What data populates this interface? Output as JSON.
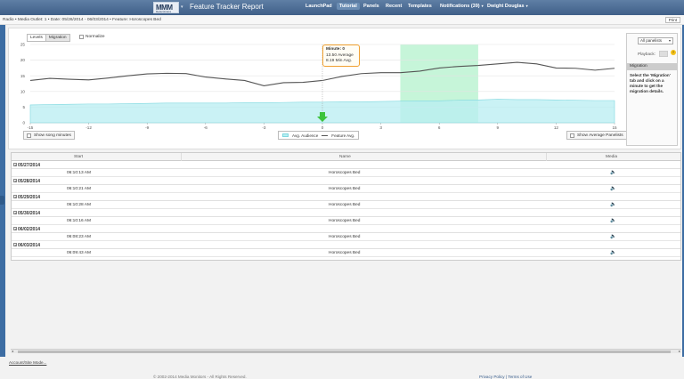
{
  "header": {
    "logo_text": "MMM",
    "logo_sub": "Media Monitors",
    "title": "Feature Tracker Report",
    "nav": [
      {
        "label": "LaunchPad"
      },
      {
        "label": "Tutorial"
      },
      {
        "label": "Panels"
      },
      {
        "label": "Recent"
      },
      {
        "label": "Templates"
      },
      {
        "label": "Notifications (39)"
      },
      {
        "label": "Dwight Douglas"
      }
    ]
  },
  "breadcrumb": "Radio • Media Outlet: 1 • Date: 05/26/2014 - 06/03/2014 • Feature: Horoscopes Bed",
  "print_label": "Print",
  "chart_controls": {
    "tabs": [
      "Levels",
      "Migration"
    ],
    "normalize_label": "Normalize",
    "song_minutes_label": "Show song minutes",
    "avg_panelists_label": "Show Average Panelists"
  },
  "tooltip": {
    "title": "Minute: 0",
    "line1": "13.50 Average",
    "line2": "8.19 Min Avg."
  },
  "chart_data": {
    "type": "line",
    "x": [
      -15,
      -14,
      -13,
      -12,
      -11,
      -10,
      -9,
      -8,
      -7,
      -6,
      -5,
      -4,
      -3,
      -2,
      -1,
      0,
      1,
      2,
      3,
      4,
      5,
      6,
      7,
      8,
      9,
      10,
      11,
      12,
      13,
      14,
      15
    ],
    "xticks": [
      -15,
      -12,
      -9,
      -6,
      -3,
      0,
      3,
      6,
      9,
      12,
      15
    ],
    "ylim": [
      0,
      25
    ],
    "yticks": [
      0,
      5,
      10,
      15,
      20,
      25
    ],
    "series": [
      {
        "name": "Feature Avg.",
        "type": "line",
        "color": "#555555",
        "values": [
          13.5,
          14.2,
          13.9,
          13.7,
          14.3,
          15.0,
          15.6,
          15.8,
          15.7,
          14.6,
          14.0,
          13.5,
          11.8,
          12.8,
          12.9,
          13.5,
          14.8,
          15.7,
          16.0,
          16.0,
          16.5,
          17.5,
          18.0,
          18.3,
          18.8,
          19.3,
          18.8,
          17.5,
          17.4,
          16.8,
          17.4
        ]
      },
      {
        "name": "Avg. Audience",
        "type": "area",
        "color": "#b8eef2",
        "values": [
          5.7,
          5.8,
          5.9,
          6.0,
          6.0,
          6.1,
          6.2,
          6.3,
          6.3,
          6.3,
          6.3,
          6.4,
          6.4,
          6.5,
          6.6,
          6.6,
          6.7,
          6.7,
          6.8,
          6.9,
          7.0,
          7.0,
          7.2,
          7.3,
          7.5,
          7.4,
          7.4,
          7.3,
          7.2,
          7.1,
          7.1
        ]
      }
    ],
    "highlight_range": [
      4,
      8
    ],
    "highlight_color": "#c6f5d9",
    "marker_x": 0,
    "marker_color": "#3cc33c"
  },
  "side_panel": {
    "select_value": "All panelists",
    "playback_label": "Playback:",
    "help_label": "?",
    "migration_title": "Migration",
    "migration_text": "Select the 'Migration' tab and click on a minute to get the migration details."
  },
  "table": {
    "columns": [
      "Start",
      "Name",
      "Media"
    ],
    "groups": [
      {
        "date": "05/27/2014",
        "rows": [
          {
            "start": "06:10:13 AM",
            "name": "Horoscopes Bed"
          }
        ]
      },
      {
        "date": "05/28/2014",
        "rows": [
          {
            "start": "06:10:21 AM",
            "name": "Horoscopes Bed"
          }
        ]
      },
      {
        "date": "05/29/2014",
        "rows": [
          {
            "start": "06:10:28 AM",
            "name": "Horoscopes Bed"
          }
        ]
      },
      {
        "date": "05/30/2014",
        "rows": [
          {
            "start": "06:10:16 AM",
            "name": "Horoscopes Bed"
          }
        ]
      },
      {
        "date": "06/02/2014",
        "rows": [
          {
            "start": "06:08:23 AM",
            "name": "Horoscopes Bed"
          }
        ]
      },
      {
        "date": "06/03/2014",
        "rows": [
          {
            "start": "06:09:43 AM",
            "name": "Horoscopes Bed"
          }
        ]
      }
    ],
    "media_icon": "speaker-icon"
  },
  "footer": {
    "account_link": "Account/Site Mode...",
    "copyright": "© 2002-2014 Media Monitors - All Rights Reserved.",
    "privacy": "Privacy Policy",
    "separator": "|",
    "terms": "Terms of Use"
  }
}
